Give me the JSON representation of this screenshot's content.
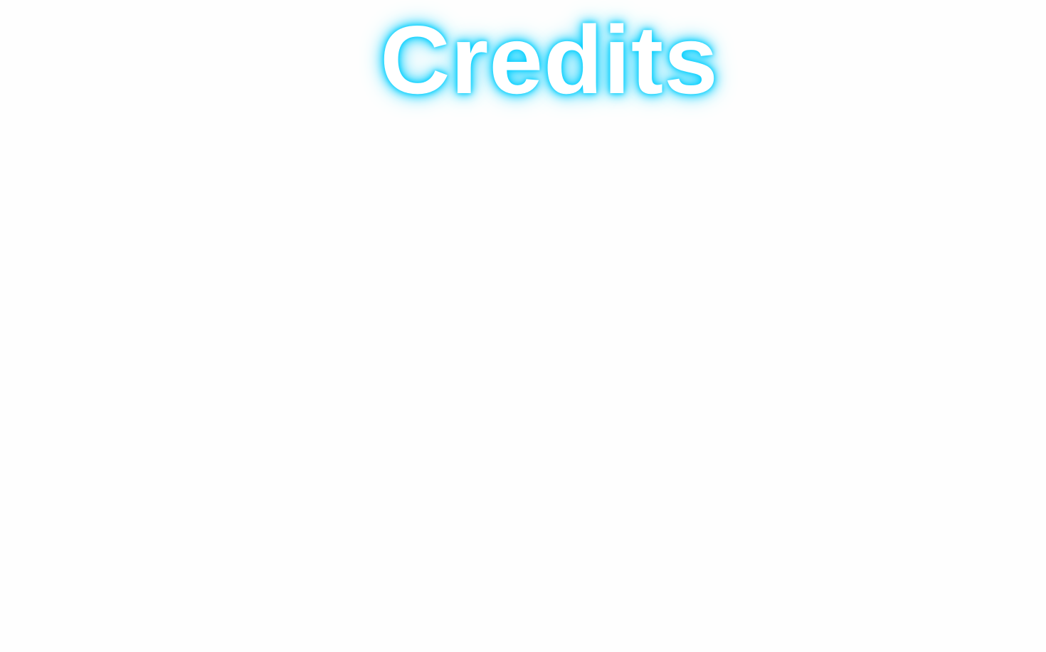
{
  "screen": {
    "title": "Credits",
    "glow_color": "#0ad0ff",
    "background_color": "#fefefe"
  }
}
